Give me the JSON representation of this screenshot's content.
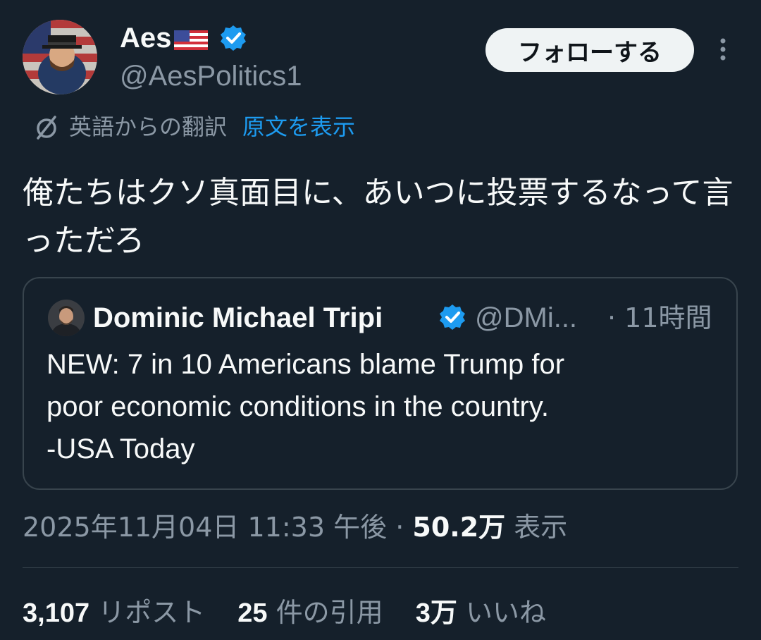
{
  "author": {
    "display_name": "Aes",
    "flag_icon": "us-flag-icon",
    "verified_color": "#1d9bf0",
    "handle": "@AesPolitics1"
  },
  "follow_label": "フォローする",
  "translation": {
    "label": "英語からの翻訳",
    "show_original": "原文を表示"
  },
  "tweet_text": "俺たちはクソ真面目に、あいつに投票するなって言っただろ",
  "quote": {
    "display_name": "Dominic Michael Tripi",
    "handle": "@DMi...",
    "time": "· 11時間",
    "lines": [
      "NEW: 7 in 10 Americans blame Trump for",
      "poor economic conditions in the country.",
      "-USA Today"
    ]
  },
  "meta": {
    "timestamp": "2025年11月04日 11:33 午後",
    "separator": "·",
    "views_count": "50.2万",
    "views_label": "表示"
  },
  "stats": {
    "reposts_value": "3,107",
    "reposts_label": "リポスト",
    "quotes_value": "25",
    "quotes_label": "件の引用",
    "likes_value": "3万",
    "likes_label": "いいね"
  },
  "colors": {
    "background": "#15202b",
    "accent": "#1d9bf0",
    "muted": "#8b98a5"
  }
}
